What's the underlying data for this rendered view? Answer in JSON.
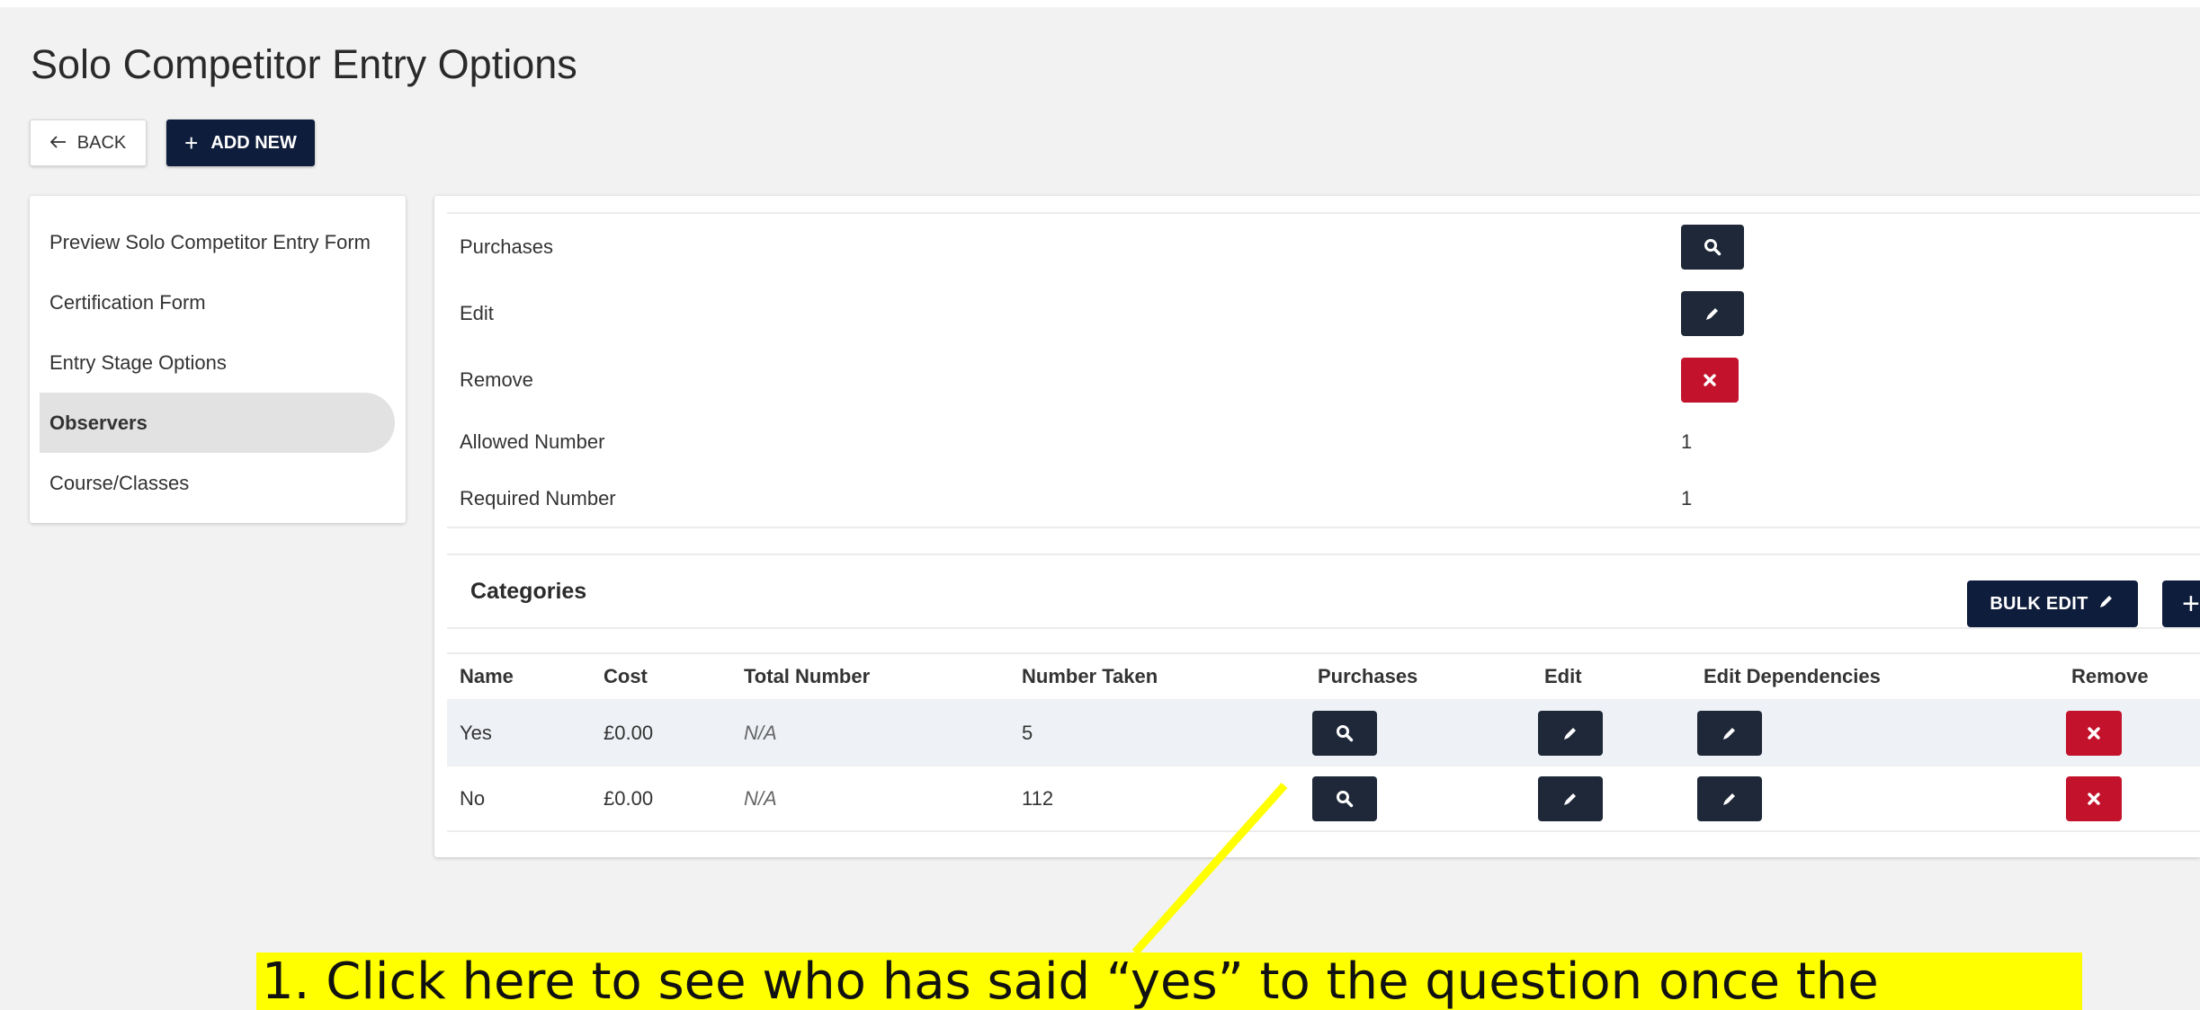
{
  "page": {
    "title": "Solo Competitor Entry Options"
  },
  "toolbar": {
    "back_label": "BACK",
    "back_icon": "arrow-left-icon",
    "add_new_label": "ADD NEW",
    "add_new_icon": "plus-icon"
  },
  "sidebar": {
    "items": [
      {
        "label": "Preview Solo Competitor Entry Form",
        "active": false
      },
      {
        "label": "Certification Form",
        "active": false
      },
      {
        "label": "Entry Stage Options",
        "active": false
      },
      {
        "label": "Observers",
        "active": true
      },
      {
        "label": "Course/Classes",
        "active": false
      }
    ]
  },
  "properties": {
    "purchases_label": "Purchases",
    "edit_label": "Edit",
    "remove_label": "Remove",
    "allowed_number_label": "Allowed Number",
    "allowed_number_value": "1",
    "required_number_label": "Required Number",
    "required_number_value": "1"
  },
  "categories": {
    "title": "Categories",
    "bulk_edit_label": "BULK EDIT",
    "columns": [
      "Name",
      "Cost",
      "Total Number",
      "Number Taken",
      "Purchases",
      "Edit",
      "Edit Dependencies",
      "Remove"
    ],
    "rows": [
      {
        "name": "Yes",
        "cost": "£0.00",
        "total_number": "N/A",
        "number_taken": "5"
      },
      {
        "name": "No",
        "cost": "£0.00",
        "total_number": "N/A",
        "number_taken": "112"
      }
    ]
  },
  "annotation": {
    "text": "1. Click here to see who has said “yes” to the question once the"
  },
  "colors": {
    "dark_button": "#1e2838",
    "navy_button": "#0f1d3c",
    "danger": "#c3122b",
    "annotation_highlight": "#ffff00"
  }
}
